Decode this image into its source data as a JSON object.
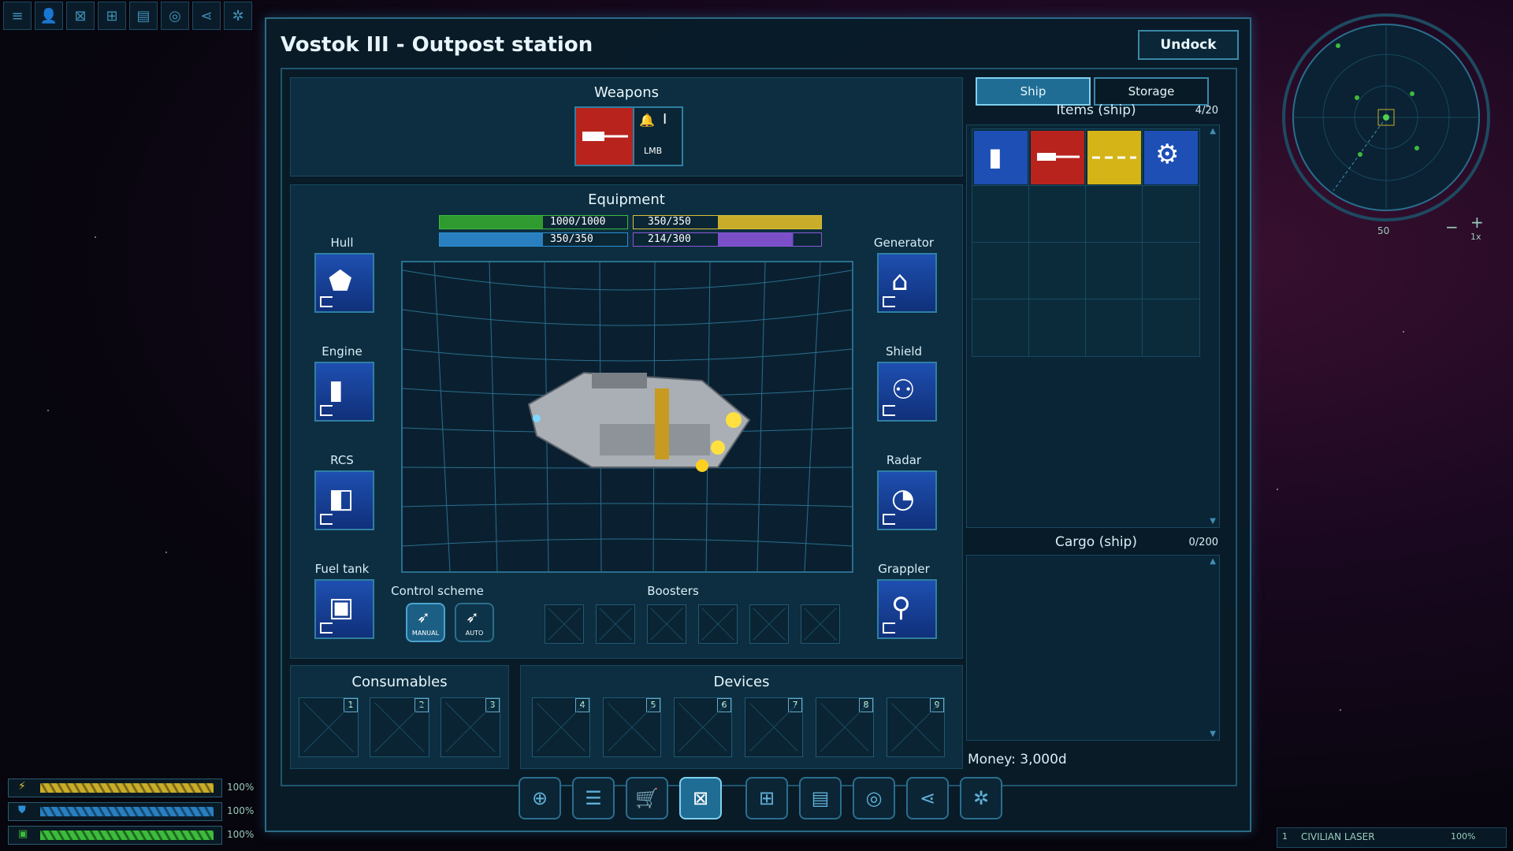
{
  "window": {
    "title": "Vostok III - Outpost station",
    "undock_label": "Undock"
  },
  "weapons": {
    "title": "Weapons",
    "key_hint": "LMB"
  },
  "equipment": {
    "title": "Equipment",
    "bars": {
      "hull": "1000/1000",
      "energy": "350/350",
      "shield": "350/350",
      "fuel": "214/300"
    },
    "left_slots": [
      {
        "label": "Hull",
        "icon": "hull-icon"
      },
      {
        "label": "Engine",
        "icon": "engine-icon"
      },
      {
        "label": "RCS",
        "icon": "rcs-icon"
      },
      {
        "label": "Fuel tank",
        "icon": "fuel-tank-icon"
      }
    ],
    "right_slots": [
      {
        "label": "Generator",
        "icon": "generator-icon"
      },
      {
        "label": "Shield",
        "icon": "shield-icon"
      },
      {
        "label": "Radar",
        "icon": "radar-icon"
      },
      {
        "label": "Grappler",
        "icon": "grappler-icon"
      }
    ],
    "control_scheme": {
      "title": "Control scheme",
      "manual": "MANUAL",
      "auto": "AUTO"
    },
    "boosters": {
      "title": "Boosters"
    }
  },
  "consumables": {
    "title": "Consumables",
    "slots": [
      "1",
      "2",
      "3"
    ]
  },
  "devices": {
    "title": "Devices",
    "slots": [
      "4",
      "5",
      "6",
      "7",
      "8",
      "9"
    ]
  },
  "inventory": {
    "tabs": [
      "Ship",
      "Storage"
    ],
    "items_title": "Items (ship)",
    "items_count": "4/20",
    "cargo_title": "Cargo (ship)",
    "cargo_count": "0/200",
    "money": "Money: 3,000d"
  },
  "minimap": {
    "range": "50",
    "zoom": "1x"
  },
  "status": {
    "energy": "100%",
    "shield": "100%",
    "hull": "100%"
  },
  "weapon_readout": {
    "slot": "1",
    "name": "CIVILIAN LASER",
    "value": "100%"
  },
  "colors": {
    "accent": "#2f7fa3",
    "hull": "#3dbb3d",
    "energy": "#d8c03a",
    "shield": "#2a8fd6",
    "fuel": "#8a58d8",
    "weapon": "#c0302a"
  }
}
